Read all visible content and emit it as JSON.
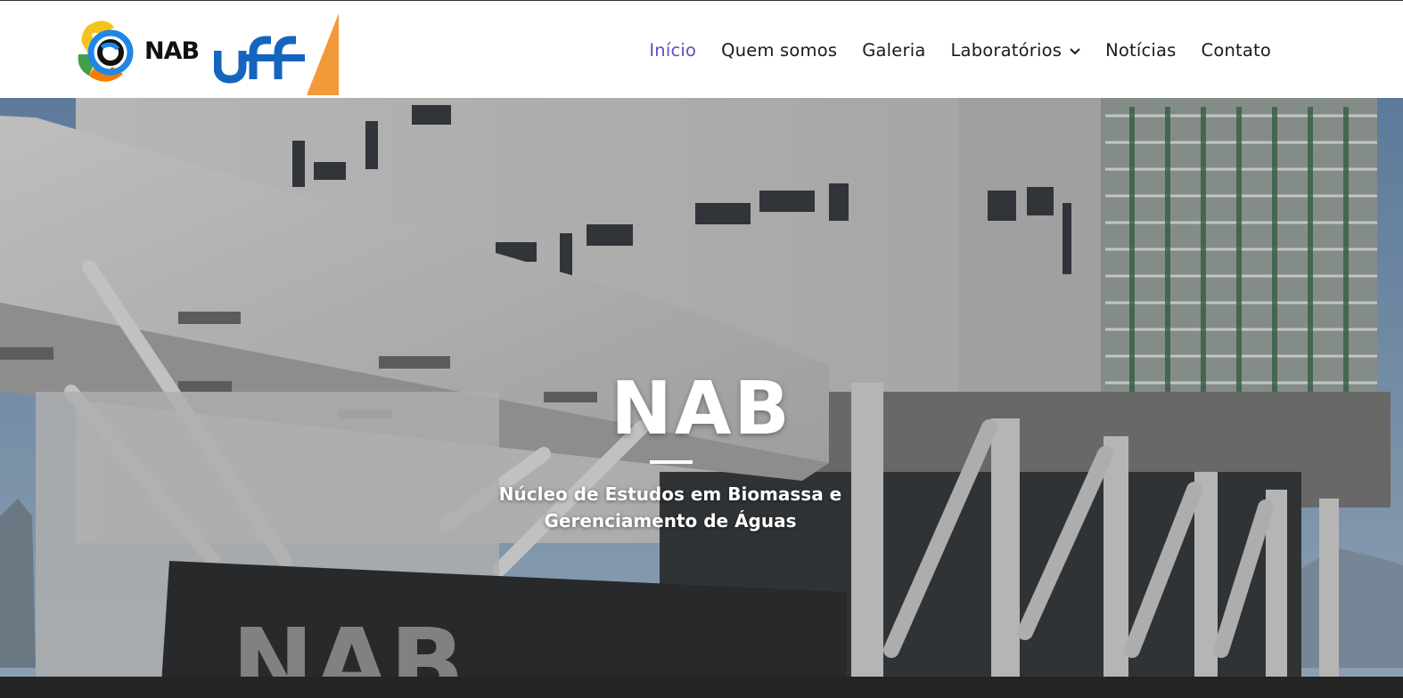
{
  "header": {
    "logo_text": "NAB",
    "uff_logo_text": "uff",
    "nav": [
      {
        "label": "Início",
        "active": true
      },
      {
        "label": "Quem somos"
      },
      {
        "label": "Galeria"
      },
      {
        "label": "Laboratórios",
        "has_dropdown": true,
        "icon": "chevron-down-icon"
      },
      {
        "label": "Notícias"
      },
      {
        "label": "Contato"
      }
    ]
  },
  "hero": {
    "title": "NAB",
    "subtitle": "Núcleo de Estudos em Biomassa e Gerenciamento de Águas",
    "sign_text": "NAB"
  },
  "colors": {
    "nav_active": "#5b4fc6",
    "nav_text": "#1a1a1a",
    "uff_blue": "#1565c0",
    "uff_orange": "#f29a3a",
    "nab_yellow": "#f6c21c",
    "nab_blue": "#1e88e5",
    "nab_green": "#43a047",
    "nab_orange": "#f57c00"
  }
}
